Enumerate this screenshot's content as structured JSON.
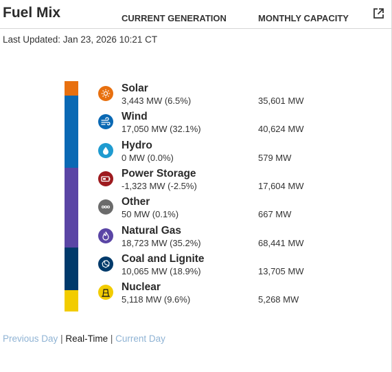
{
  "header": {
    "title": "Fuel Mix"
  },
  "last_updated": "Last Updated: Jan 23, 2026 10:21 CT",
  "columns": {
    "generation": "CURRENT GENERATION",
    "capacity": "MONTHLY CAPACITY"
  },
  "fuels": [
    {
      "name": "Solar",
      "generation": "3,443 MW (6.5%)",
      "capacity": "35,601 MW",
      "color": "#e8700f",
      "icon": "sun-icon"
    },
    {
      "name": "Wind",
      "generation": "17,050 MW (32.1%)",
      "capacity": "40,624 MW",
      "color": "#0a69b4",
      "icon": "wind-icon"
    },
    {
      "name": "Hydro",
      "generation": "0 MW (0.0%)",
      "capacity": "579 MW",
      "color": "#1f9bd0",
      "icon": "water-drop-icon"
    },
    {
      "name": "Power Storage",
      "generation": "-1,323 MW (-2.5%)",
      "capacity": "17,604 MW",
      "color": "#9e1b1f",
      "icon": "battery-icon"
    },
    {
      "name": "Other",
      "generation": "50 MW (0.1%)",
      "capacity": "667 MW",
      "color": "#6b6b6b",
      "icon": "dots-icon"
    },
    {
      "name": "Natural Gas",
      "generation": "18,723 MW (35.2%)",
      "capacity": "68,441 MW",
      "color": "#5a45a5",
      "icon": "flame-icon"
    },
    {
      "name": "Coal and Lignite",
      "generation": "10,065 MW (18.9%)",
      "capacity": "13,705 MW",
      "color": "#003a6b",
      "icon": "coal-icon"
    },
    {
      "name": "Nuclear",
      "generation": "5,118 MW (9.6%)",
      "capacity": "5,268 MW",
      "color": "#f2cc00",
      "icon": "nuclear-plant-icon"
    }
  ],
  "mix_bar": [
    {
      "fuel": "Solar",
      "share": 6.5,
      "color": "#e8700f"
    },
    {
      "fuel": "Wind",
      "share": 32.1,
      "color": "#0a69b4"
    },
    {
      "fuel": "Natural Gas",
      "share": 35.2,
      "color": "#5a45a5"
    },
    {
      "fuel": "Coal and Lignite",
      "share": 18.9,
      "color": "#003a6b"
    },
    {
      "fuel": "Nuclear",
      "share": 9.6,
      "color": "#f2cc00"
    }
  ],
  "footer": {
    "previous_day": "Previous Day",
    "separator": "|",
    "real_time": "Real-Time",
    "current_day": "Current Day"
  }
}
